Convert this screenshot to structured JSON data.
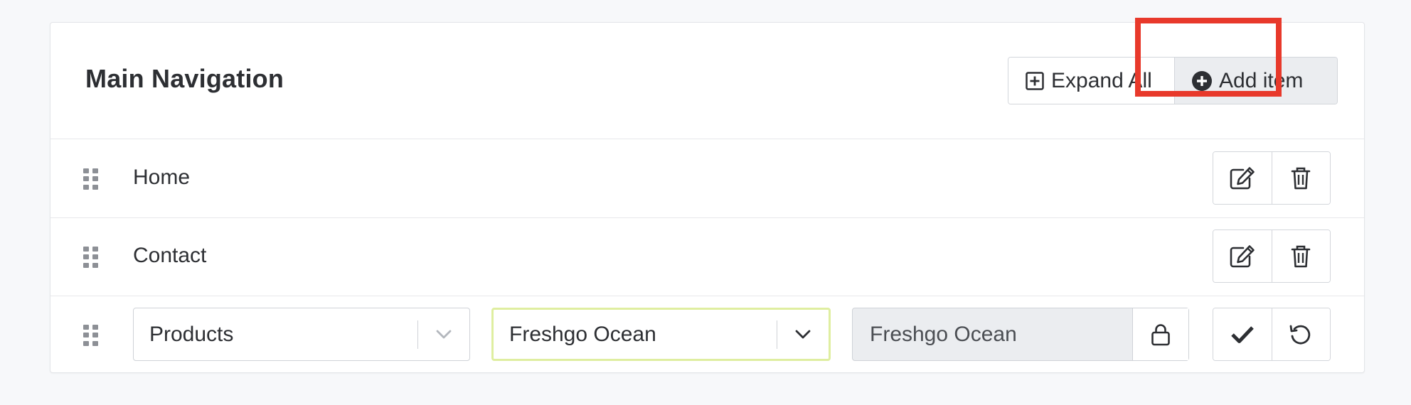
{
  "menu": {
    "title": "Main Navigation",
    "expand_all_label": "Expand All",
    "add_item_label": "Add item"
  },
  "items": [
    {
      "label": "Home"
    },
    {
      "label": "Contact"
    }
  ],
  "editing_row": {
    "type_select_value": "Products",
    "target_select_value": "Freshgo Ocean",
    "locked_field_value": "Freshgo Ocean"
  },
  "icons": {
    "drag": "drag-handle-icon",
    "expand": "plus-square-icon",
    "add": "plus-circle-icon",
    "edit": "edit-icon",
    "delete": "trash-icon",
    "chevron": "chevron-down-icon",
    "lock": "lock-icon",
    "confirm": "check-icon",
    "reset": "undo-icon"
  },
  "colors": {
    "highlight": "#e8392b",
    "focus_border": "#dfeea0"
  }
}
